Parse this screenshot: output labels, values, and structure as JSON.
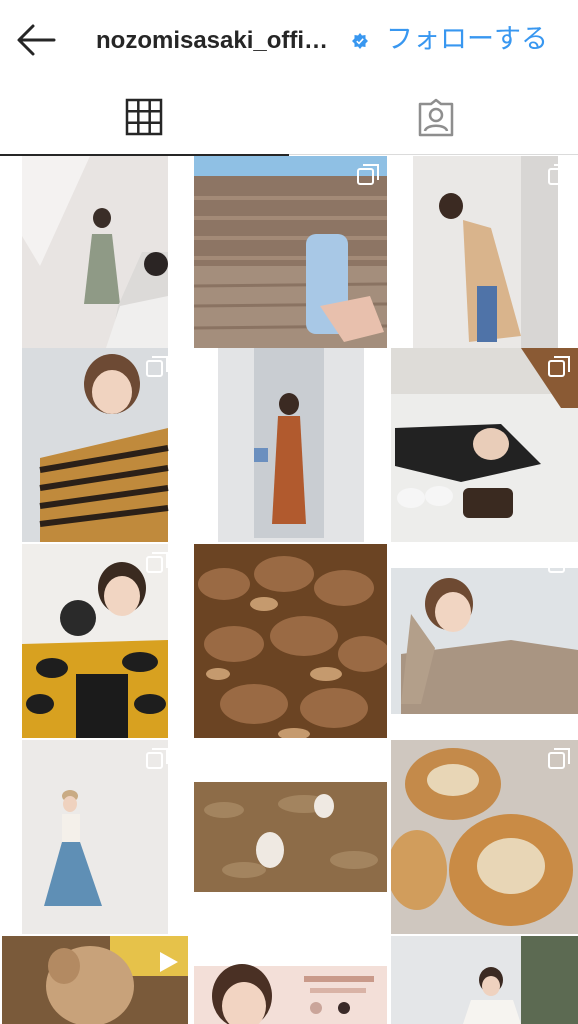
{
  "header": {
    "username": "nozomisasaki_offi…",
    "follow_label": "フォローする"
  },
  "icons": {
    "back": "arrow-left-icon",
    "verified": "verified-badge-icon",
    "grid_tab": "grid-icon",
    "tagged_tab": "person-tag-icon",
    "multi_post": "carousel-icon",
    "video_post": "video-icon"
  },
  "colors": {
    "accent": "#3897f0",
    "text": "#262626"
  },
  "posts": [
    {
      "id": 1,
      "multi": false
    },
    {
      "id": 2,
      "multi": true
    },
    {
      "id": 3,
      "multi": true
    },
    {
      "id": 4,
      "multi": true
    },
    {
      "id": 5,
      "multi": false
    },
    {
      "id": 6,
      "multi": true
    },
    {
      "id": 7,
      "multi": true
    },
    {
      "id": 8,
      "multi": false
    },
    {
      "id": 9,
      "multi": true
    },
    {
      "id": 10,
      "multi": true
    },
    {
      "id": 11,
      "multi": true
    },
    {
      "id": 12,
      "multi": true
    },
    {
      "id": 13,
      "video": true
    },
    {
      "id": 14,
      "multi": true
    },
    {
      "id": 15,
      "multi": false
    }
  ]
}
